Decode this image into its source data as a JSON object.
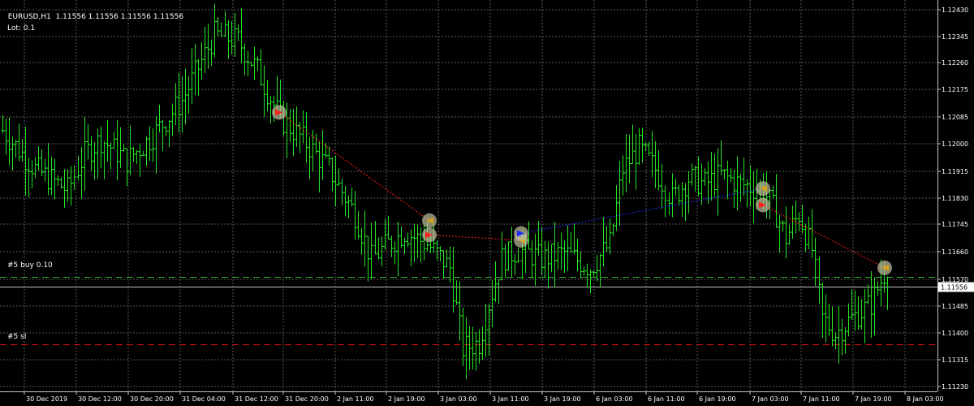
{
  "header": {
    "symbol": "EURUSD,H1",
    "ohlc": "1.11556 1.11556 1.11556 1.11556",
    "lot": "Lot: 0.1"
  },
  "levels": {
    "buy_label": "#5 buy 0.10",
    "sl_label": "#5 sl"
  },
  "colors": {
    "background": "#000000",
    "grid": "#5a5a5a",
    "bars": "#25e625",
    "sell_line": "#ff2020",
    "buy_line": "#2030ff",
    "entry_level": "#2faf2f",
    "stop_level": "#e01010",
    "text": "#ffffff"
  },
  "chart_data": {
    "type": "ohlc",
    "title": "EURUSD,H1",
    "ylim": [
      1.1119,
      1.125
    ],
    "y_ticks": [
      "1.12430",
      "1.12345",
      "1.12260",
      "1.12175",
      "1.12085",
      "1.12000",
      "1.11915",
      "1.11830",
      "1.11745",
      "1.11660",
      "1.11570",
      "1.11485",
      "1.11400",
      "1.11315",
      "1.11230"
    ],
    "current_price": "1.11556",
    "x_labels": [
      "30 Dec 2019",
      "30 Dec 12:00",
      "30 Dec 20:00",
      "31 Dec 04:00",
      "31 Dec 12:00",
      "31 Dec 20:00",
      "2 Jan 11:00",
      "2 Jan 19:00",
      "3 Jan 03:00",
      "3 Jan 11:00",
      "3 Jan 19:00",
      "6 Jan 03:00",
      "6 Jan 11:00",
      "6 Jan 19:00",
      "7 Jan 03:00",
      "7 Jan 11:00",
      "7 Jan 19:00",
      "8 Jan 03:00"
    ],
    "close_anchors": [
      [
        0,
        1.1208
      ],
      [
        10,
        1.1195
      ],
      [
        20,
        1.1188
      ],
      [
        25,
        1.12
      ],
      [
        30,
        1.1205
      ],
      [
        38,
        1.1198
      ],
      [
        45,
        1.1205
      ],
      [
        55,
        1.1218
      ],
      [
        65,
        1.124
      ],
      [
        72,
        1.1238
      ],
      [
        78,
        1.1228
      ],
      [
        85,
        1.1212
      ],
      [
        92,
        1.1205
      ],
      [
        100,
        1.1195
      ],
      [
        108,
        1.118
      ],
      [
        113,
        1.1165
      ],
      [
        118,
        1.117
      ],
      [
        123,
        1.1174
      ],
      [
        130,
        1.117
      ],
      [
        137,
        1.1162
      ],
      [
        141,
        1.1135
      ],
      [
        146,
        1.1137
      ],
      [
        149,
        1.115
      ],
      [
        153,
        1.1165
      ],
      [
        158,
        1.1168
      ],
      [
        165,
        1.1165
      ],
      [
        172,
        1.1167
      ],
      [
        180,
        1.1162
      ],
      [
        186,
        1.117
      ],
      [
        190,
        1.1195
      ],
      [
        195,
        1.1202
      ],
      [
        200,
        1.1195
      ],
      [
        205,
        1.1185
      ],
      [
        210,
        1.1192
      ],
      [
        215,
        1.119
      ],
      [
        220,
        1.1193
      ],
      [
        226,
        1.119
      ],
      [
        233,
        1.1188
      ],
      [
        237,
        1.118
      ],
      [
        240,
        1.1172
      ],
      [
        244,
        1.118
      ],
      [
        248,
        1.1168
      ],
      [
        251,
        1.1145
      ],
      [
        255,
        1.114
      ],
      [
        260,
        1.1145
      ],
      [
        266,
        1.115
      ],
      [
        270,
        1.116
      ]
    ],
    "series": [
      {
        "type": "sell",
        "points": [
          [
            "30 Dec 20:00",
            1.1214
          ],
          [
            "3 Jan 03:00",
            1.11778
          ]
        ]
      },
      {
        "type": "sell",
        "points": [
          [
            "3 Jan 03:00",
            1.1173
          ],
          [
            "3 Jan 19:00",
            1.11712
          ]
        ]
      },
      {
        "type": "buy",
        "points": [
          [
            "3 Jan 19:00",
            1.11735
          ],
          [
            "7 Jan 03:00",
            1.11885
          ]
        ]
      },
      {
        "type": "sell",
        "points": [
          [
            "7 Jan 03:00",
            1.1183
          ],
          [
            "8 Jan 03:00",
            1.1162
          ]
        ]
      }
    ],
    "levels": [
      {
        "name": "#5 buy 0.10",
        "price": 1.1159,
        "style": "dashed",
        "color": "green"
      },
      {
        "name": "#5 sl",
        "price": 1.11365,
        "style": "dashed",
        "color": "red"
      },
      {
        "name": "current",
        "price": 1.11556,
        "style": "solid",
        "color": "white"
      }
    ],
    "grid": true
  }
}
